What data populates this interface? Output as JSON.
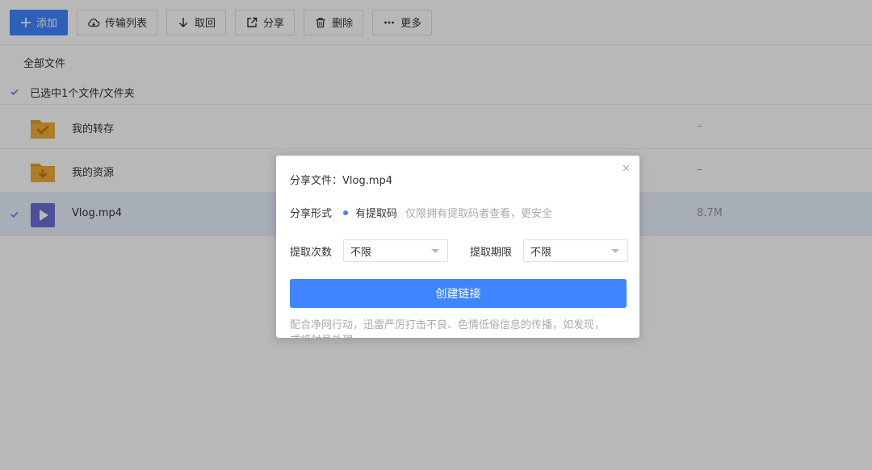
{
  "toolbar": {
    "add_label": "添加",
    "transfer_label": "传输列表",
    "retrieve_label": "取回",
    "share_label": "分享",
    "delete_label": "删除",
    "more_label": "更多"
  },
  "breadcrumb": "全部文件",
  "selection": {
    "text": "已选中1个文件/文件夹"
  },
  "files": [
    {
      "name": "我的转存",
      "size": "–",
      "type": "folder-saved",
      "selected": false
    },
    {
      "name": "我的资源",
      "size": "–",
      "type": "folder-download",
      "selected": false
    },
    {
      "name": "Vlog.mp4",
      "size": "8.7M",
      "type": "video",
      "selected": true
    }
  ],
  "share_dialog": {
    "file_label": "分享文件：",
    "file_name": "Vlog.mp4",
    "form_label": "分享形式",
    "form_option": "有提取码",
    "form_hint": "仅限拥有提取码者查看，更安全",
    "count_label": "提取次数",
    "count_value": "不限",
    "period_label": "提取期限",
    "period_value": "不限",
    "create_button": "创建链接",
    "notice_line1": "配合净网行动，迅雷严厉打击不良、色情低俗信息的传播，如发现，",
    "notice_line2": "或将封号处理。"
  },
  "colors": {
    "accent": "#3f85ff",
    "folder": "#f0a830",
    "video": "#6a6fd6",
    "selected_row": "#e9f1ff"
  }
}
